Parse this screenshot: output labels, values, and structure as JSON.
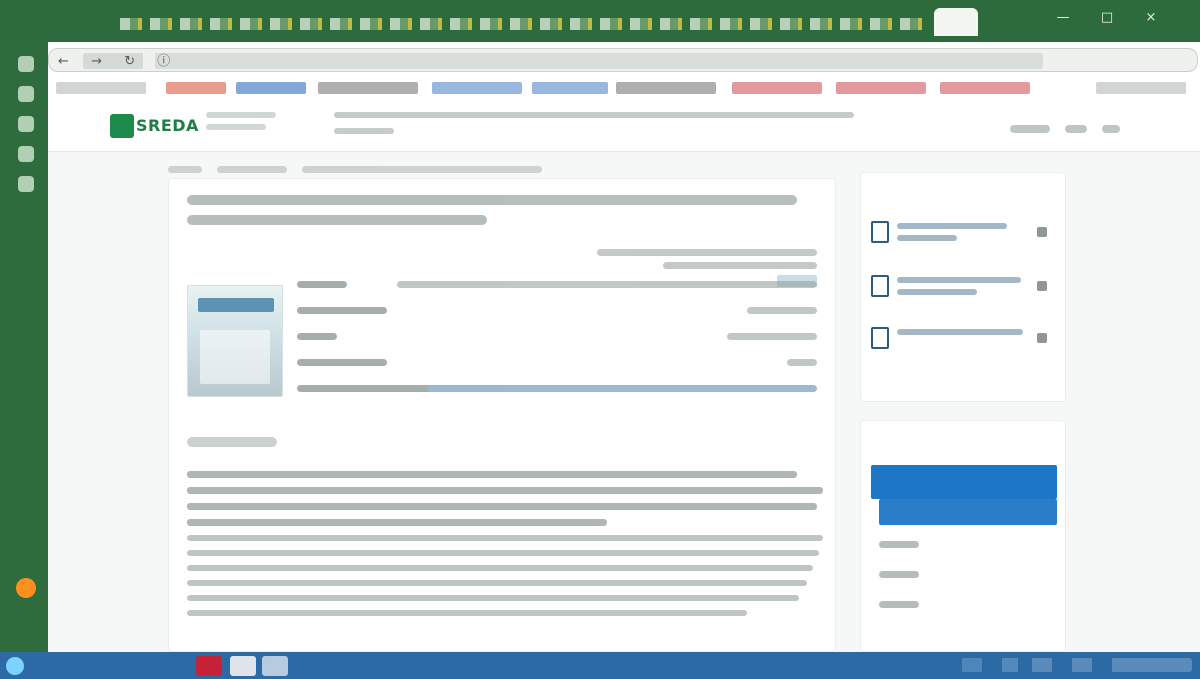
{
  "browser": {
    "brand_text": "SREDA"
  },
  "page": {
    "docs_title": "",
    "issues_title": "",
    "issues_years": [],
    "breadcrumb_items": [],
    "main_title": "",
    "meta": {
      "doi_label": "",
      "doi_value": "",
      "open_access_label": "",
      "badge": "",
      "rows": [
        {
          "k": "",
          "v": ""
        },
        {
          "k": "",
          "v": ""
        },
        {
          "k": "",
          "v": ""
        },
        {
          "k": "",
          "v": ""
        },
        {
          "k": "",
          "v": ""
        },
        {
          "k": "",
          "v": ""
        }
      ]
    },
    "section_title": "",
    "body_paragraphs": []
  },
  "colors": {
    "tabstrip": "#2e6b3c",
    "sidebar": "#2f6c3d",
    "accent_blue": "#1e76c6",
    "brand_green": "#1f7e47",
    "taskbar": "#2c6aa6"
  },
  "icons": {
    "window_controls": [
      "minimize-icon",
      "maximize-icon",
      "close-icon"
    ],
    "doc": "document-icon",
    "download": "download-icon"
  }
}
